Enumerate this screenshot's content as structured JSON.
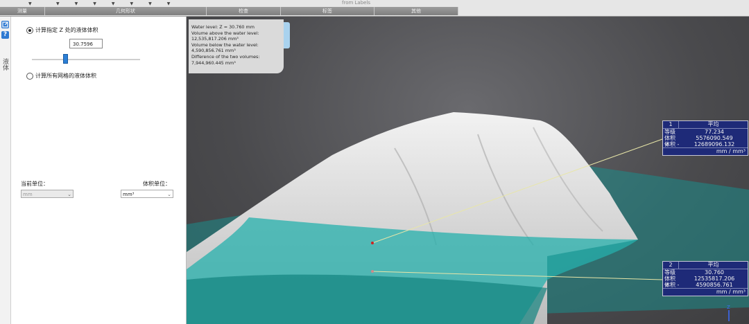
{
  "ribbon": {
    "groups": [
      "测量",
      "几何形状",
      "检查",
      "标签",
      "其他"
    ],
    "from_labels": "from Labels"
  },
  "sidebar": {
    "icon1": "link-icon",
    "icon2": "help-icon",
    "help_glyph": "?",
    "tab_label": "液体"
  },
  "panel": {
    "option_z": "计算指定 Z 处的液体体积",
    "z_value": "30.7596",
    "slider_value_fraction": 0.31,
    "option_all": "计算所有网格的液体体积",
    "current_unit_label": "当前单位：",
    "volume_unit_label": "体积单位：",
    "current_unit_value": "mm",
    "volume_unit_value": "mm³"
  },
  "info": {
    "lines": [
      "Water level: Z = 30.760 mm",
      "Volume above the water level:",
      "12,535,817.206 mm³",
      "Volume below the water level:",
      "4,590,856.761 mm³",
      "Difference of the two volumes:",
      "7,944,960.445 mm³"
    ]
  },
  "labels": [
    {
      "number": "1",
      "stat": "平均",
      "rows": [
        {
          "key": "等级",
          "value": "77.234"
        },
        {
          "key": "体积 +",
          "value": "5576090.549"
        },
        {
          "key": "体积 -",
          "value": "12689096.132"
        }
      ],
      "unit": "mm / mm³"
    },
    {
      "number": "2",
      "stat": "平均",
      "rows": [
        {
          "key": "等级",
          "value": "30.760"
        },
        {
          "key": "体积 +",
          "value": "12535817.206"
        },
        {
          "key": "体积 -",
          "value": "4590856.761"
        }
      ],
      "unit": "mm / mm³"
    }
  ],
  "axis": {
    "z": "Z"
  },
  "colors": {
    "water": "#1fa3a0",
    "label_bg": "#1e2a78",
    "mesh": "#e2e2e2"
  }
}
